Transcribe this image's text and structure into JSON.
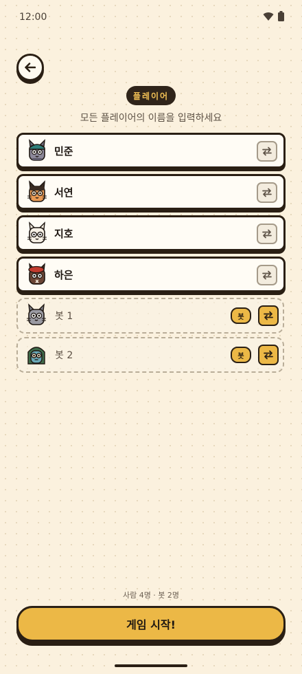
{
  "status_bar": {
    "time": "12:00",
    "icons": [
      "wifi-icon",
      "battery-icon"
    ]
  },
  "header": {
    "back_icon": "arrow-left-icon",
    "badge": "플레이어",
    "subtitle": "모든 플레이어의 이름을 입력하세요"
  },
  "players": [
    {
      "name": "민준",
      "avatar": "cat-beanie-blue-icon"
    },
    {
      "name": "서연",
      "avatar": "cat-orange-glasses-icon"
    },
    {
      "name": "지호",
      "avatar": "cat-white-glasses-icon"
    },
    {
      "name": "하은",
      "avatar": "cat-red-beret-icon"
    }
  ],
  "bots": [
    {
      "name": "봇 1",
      "tag": "봇",
      "avatar": "cat-gray-icon"
    },
    {
      "name": "봇 2",
      "tag": "봇",
      "avatar": "cat-green-hood-icon"
    }
  ],
  "footer": {
    "count_text": "사람 4명 · 봇 2명",
    "start_label": "게임 시작!"
  },
  "colors": {
    "background": "#fbf1de",
    "accent": "#ecb846",
    "ink": "#2a1f14"
  }
}
